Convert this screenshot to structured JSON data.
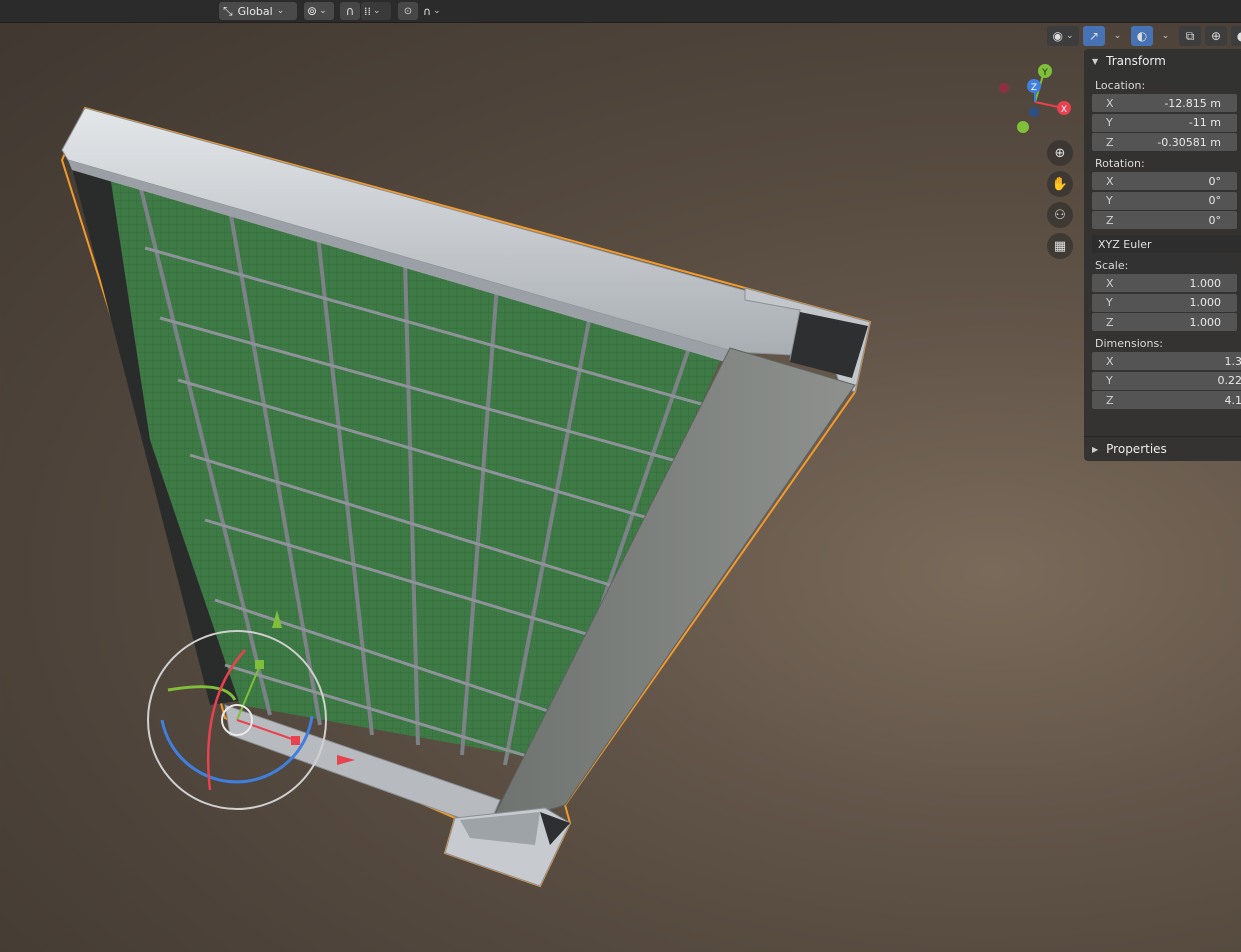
{
  "header": {
    "orientation_label": "Global",
    "icons": {
      "orientation": "transform-orientation-icon",
      "pivot": "pivot-point-icon",
      "snap": "snap-magnet-icon",
      "snap_target": "snap-increment-icon",
      "proportional": "proportional-editing-icon",
      "falloff": "falloff-curve-icon"
    }
  },
  "viewport_header": {
    "icons": [
      "visibility-eye-icon",
      "gizmo-toggle-icon",
      "overlays-icon",
      "xray-icon",
      "wireframe-shading-icon",
      "solid-shading-icon"
    ]
  },
  "nav_gizmo": {
    "x_label": "X",
    "y_label": "Y",
    "z_label": "Z"
  },
  "nav_tools": [
    "zoom-icon",
    "pan-hand-icon",
    "camera-icon",
    "grid-ortho-icon"
  ],
  "transform": {
    "title": "Transform",
    "location_label": "Location:",
    "location": [
      {
        "axis": "X",
        "value": "-12.815 m"
      },
      {
        "axis": "Y",
        "value": "-11 m"
      },
      {
        "axis": "Z",
        "value": "-0.30581 m"
      }
    ],
    "rotation_label": "Rotation:",
    "rotation": [
      {
        "axis": "X",
        "value": "0°"
      },
      {
        "axis": "Y",
        "value": "0°"
      },
      {
        "axis": "Z",
        "value": "0°"
      }
    ],
    "rotation_mode": "XYZ Euler",
    "scale_label": "Scale:",
    "scale": [
      {
        "axis": "X",
        "value": "1.000"
      },
      {
        "axis": "Y",
        "value": "1.000"
      },
      {
        "axis": "Z",
        "value": "1.000"
      }
    ],
    "dimensions_label": "Dimensions:",
    "dimensions": [
      {
        "axis": "X",
        "value": "1.3"
      },
      {
        "axis": "Y",
        "value": "0.22"
      },
      {
        "axis": "Z",
        "value": "4.1"
      }
    ]
  },
  "properties": {
    "title": "Properties"
  },
  "colors": {
    "selection_outline": "#f39a2c",
    "axis_x": "#e8414f",
    "axis_y": "#7fbf3a",
    "axis_z": "#3f7fe0",
    "panel_green": "#3f7a44",
    "frame_gray": "#b9bec4"
  }
}
